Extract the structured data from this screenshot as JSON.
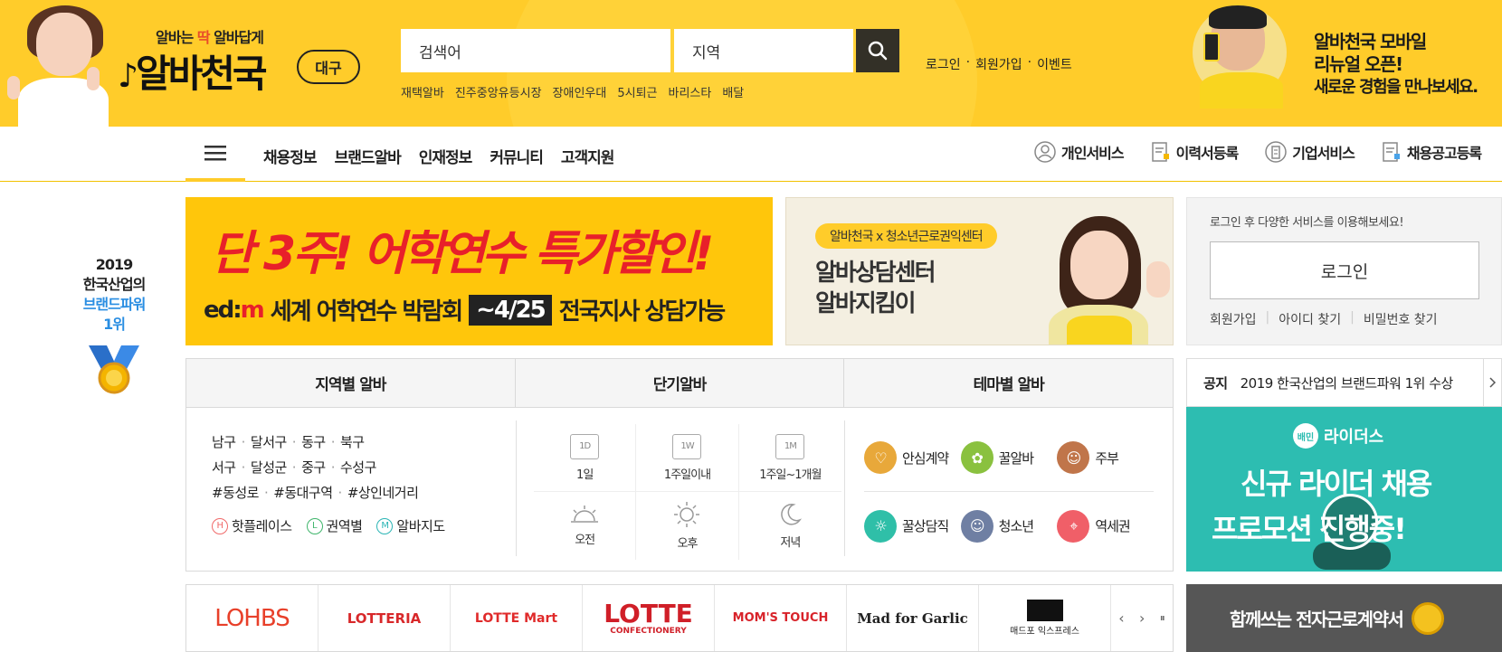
{
  "header": {
    "tagline_prefix": "알바는",
    "tagline_highlight": "딱",
    "tagline_suffix": "알바답게",
    "logo_text": "알바천국",
    "city_badge": "대구",
    "search": {
      "keyword_placeholder": "검색어",
      "location_placeholder": "지역"
    },
    "popular_keywords": [
      "재택알바",
      "진주중앙유등시장",
      "장애인우대",
      "5시퇴근",
      "바리스타",
      "배달"
    ],
    "top_links": [
      "로그인",
      "회원가입",
      "이벤트"
    ],
    "promo": {
      "line1": "알바천국 모바일",
      "line2": "리뉴얼 오픈!",
      "line3": "새로운 경험을 만나보세요."
    }
  },
  "nav": {
    "main_menu": [
      "채용정보",
      "브랜드알바",
      "인재정보",
      "커뮤니티",
      "고객지원"
    ],
    "services": [
      "개인서비스",
      "이력서등록",
      "기업서비스",
      "채용공고등록"
    ]
  },
  "award": {
    "year": "2019",
    "line2": "한국산업의",
    "line3": "브랜드파워",
    "line4": "1위"
  },
  "banner_edm": {
    "headline": "단 3주! 어학연수 특가할인!",
    "brand_prefix": "ed:",
    "brand_m": "m",
    "fair": "세계 어학연수 박람회",
    "date": "~4/25",
    "consult": "전국지사 상담가능"
  },
  "banner_center": {
    "tag": "알바천국 x 청소년근로권익센터",
    "title_line1": "알바상담센터",
    "title_line2": "알바지킴이"
  },
  "login_box": {
    "hint": "로그인 후 다양한 서비스를 이용해보세요!",
    "button": "로그인",
    "links": [
      "회원가입",
      "아이디 찾기",
      "비밀번호 찾기"
    ]
  },
  "categories": {
    "tabs": [
      "지역별 알바",
      "단기알바",
      "테마별 알바"
    ],
    "area_rows": [
      [
        "남구",
        "달서구",
        "동구",
        "북구"
      ],
      [
        "서구",
        "달성군",
        "중구",
        "수성구"
      ],
      [
        "#동성로",
        "#동대구역",
        "#상인네거리"
      ]
    ],
    "area_links": [
      {
        "letter": "H",
        "label": "핫플레이스",
        "color": "#f06a6a"
      },
      {
        "letter": "L",
        "label": "권역별",
        "color": "#3fb56b"
      },
      {
        "letter": "M",
        "label": "알바지도",
        "color": "#2bb5b5"
      }
    ],
    "short_term": [
      {
        "badge": "1D",
        "label": "1일"
      },
      {
        "badge": "1W",
        "label": "1주일이내"
      },
      {
        "badge": "1M",
        "label": "1주일~1개월"
      },
      {
        "badge": "",
        "label": "오전"
      },
      {
        "badge": "",
        "label": "오후"
      },
      {
        "badge": "",
        "label": "저녁"
      }
    ],
    "themes": [
      {
        "label": "안심계약",
        "color": "#e8a83a"
      },
      {
        "label": "꿀알바",
        "color": "#8ac13f"
      },
      {
        "label": "주부",
        "color": "#c0754a"
      },
      {
        "label": "꿀상담직",
        "color": "#2fbfa8"
      },
      {
        "label": "청소년",
        "color": "#6f7fa3"
      },
      {
        "label": "역세권",
        "color": "#f05f68"
      }
    ]
  },
  "notice": {
    "label": "공지",
    "text": "2019 한국산업의 브랜드파워 1위 수상"
  },
  "riders": {
    "brand": "라이더스",
    "brand_mark": "배민",
    "line1": "신규 라이더 채용",
    "line2": "프로모션 진행중!"
  },
  "brands": [
    {
      "name": "LOHBS",
      "color": "#e8402a"
    },
    {
      "name": "LOTTERIA",
      "color": "#d8282a"
    },
    {
      "name": "LOTTE Mart",
      "color": "#e02a2a"
    },
    {
      "name": "LOTTE",
      "sub": "CONFECTIONERY",
      "color": "#d01f28"
    },
    {
      "name": "MOM'S TOUCH",
      "color": "#d8232a"
    },
    {
      "name": "Mad for Garlic",
      "color": "#222222"
    },
    {
      "name": "매드포 익스프레스",
      "color": "#222222"
    }
  ],
  "brand_controls": [
    "‹",
    "›",
    "⏸"
  ],
  "contract_banner": "함께쓰는 전자근로계약서"
}
